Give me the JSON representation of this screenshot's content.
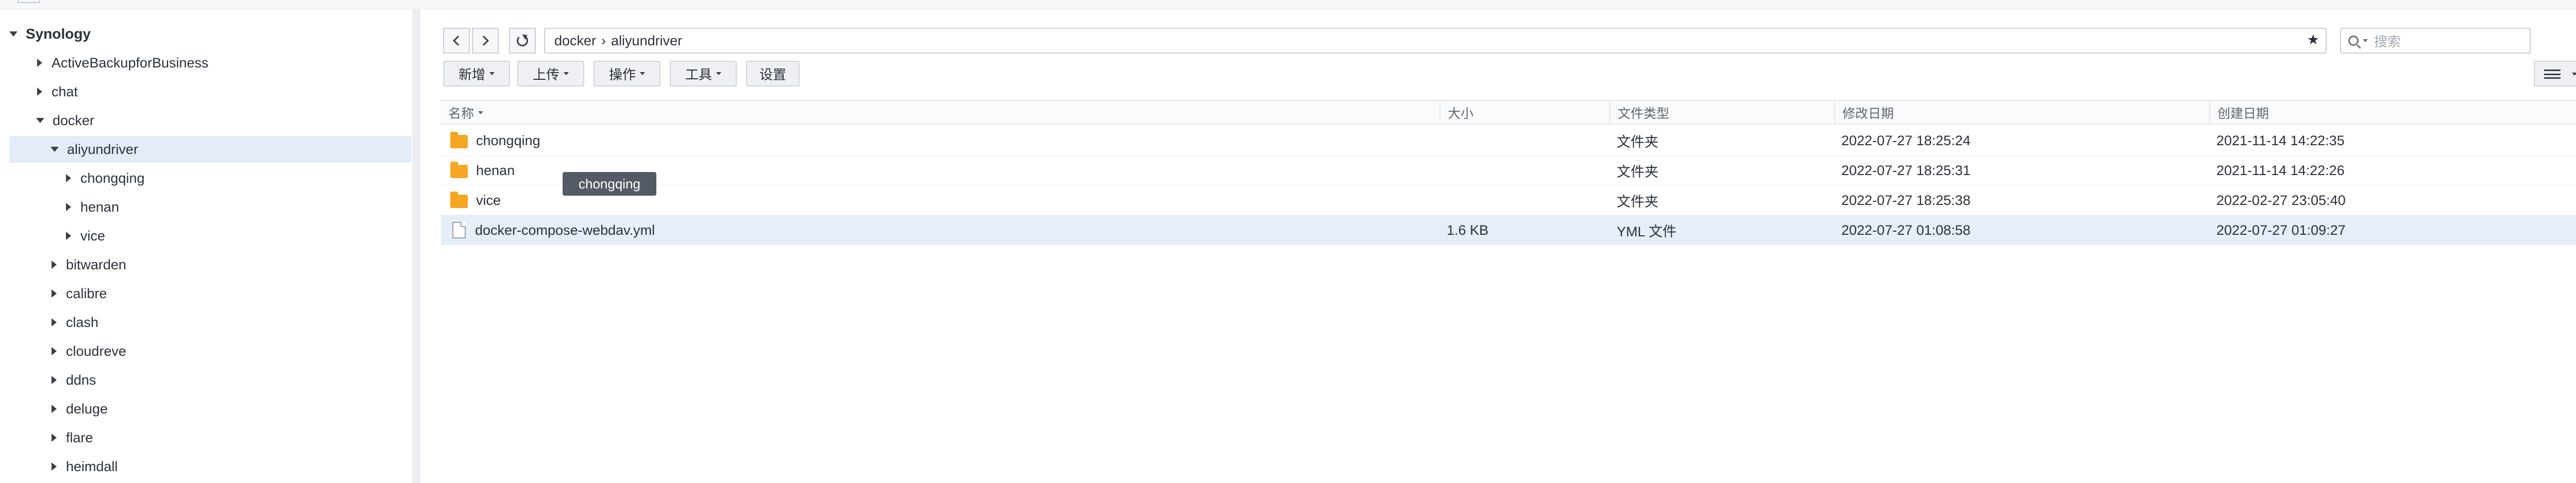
{
  "tree": {
    "root": "Synology",
    "items": [
      {
        "label": "ActiveBackupforBusiness"
      },
      {
        "label": "chat"
      },
      {
        "label": "docker"
      },
      {
        "label": "aliyundriver"
      },
      {
        "label": "chongqing"
      },
      {
        "label": "henan"
      },
      {
        "label": "vice"
      },
      {
        "label": "bitwarden"
      },
      {
        "label": "calibre"
      },
      {
        "label": "clash"
      },
      {
        "label": "cloudreve"
      },
      {
        "label": "ddns"
      },
      {
        "label": "deluge"
      },
      {
        "label": "flare"
      },
      {
        "label": "heimdall"
      }
    ]
  },
  "path": {
    "segments": [
      "docker",
      "aliyundriver"
    ],
    "separator": "›",
    "favorite_icon": "star-icon"
  },
  "search": {
    "placeholder": "搜索"
  },
  "toolbar": {
    "new_label": "新增",
    "upload_label": "上传",
    "action_label": "操作",
    "tools_label": "工具",
    "settings_label": "设置"
  },
  "table": {
    "columns": {
      "name": "名称",
      "size": "大小",
      "type": "文件类型",
      "modified": "修改日期",
      "created": "创建日期"
    },
    "rows": [
      {
        "name": "chongqing",
        "size": "",
        "type": "文件夹",
        "modified": "2022-07-27 18:25:24",
        "created": "2021-11-14 14:22:35",
        "icon": "folder-icon"
      },
      {
        "name": "henan",
        "size": "",
        "type": "文件夹",
        "modified": "2022-07-27 18:25:31",
        "created": "2021-11-14 14:22:26",
        "icon": "folder-icon"
      },
      {
        "name": "vice",
        "size": "",
        "type": "文件夹",
        "modified": "2022-07-27 18:25:38",
        "created": "2022-02-27 23:05:40",
        "icon": "folder-icon"
      },
      {
        "name": "docker-compose-webdav.yml",
        "size": "1.6 KB",
        "type": "YML 文件",
        "modified": "2022-07-27 01:08:58",
        "created": "2022-07-27 01:09:27",
        "icon": "file-icon"
      }
    ]
  },
  "tooltip": {
    "text": "chongqing"
  },
  "colors": {
    "selection": "#e3ecf8",
    "folder": "#f5a623",
    "tooltip_bg": "#545b64"
  }
}
